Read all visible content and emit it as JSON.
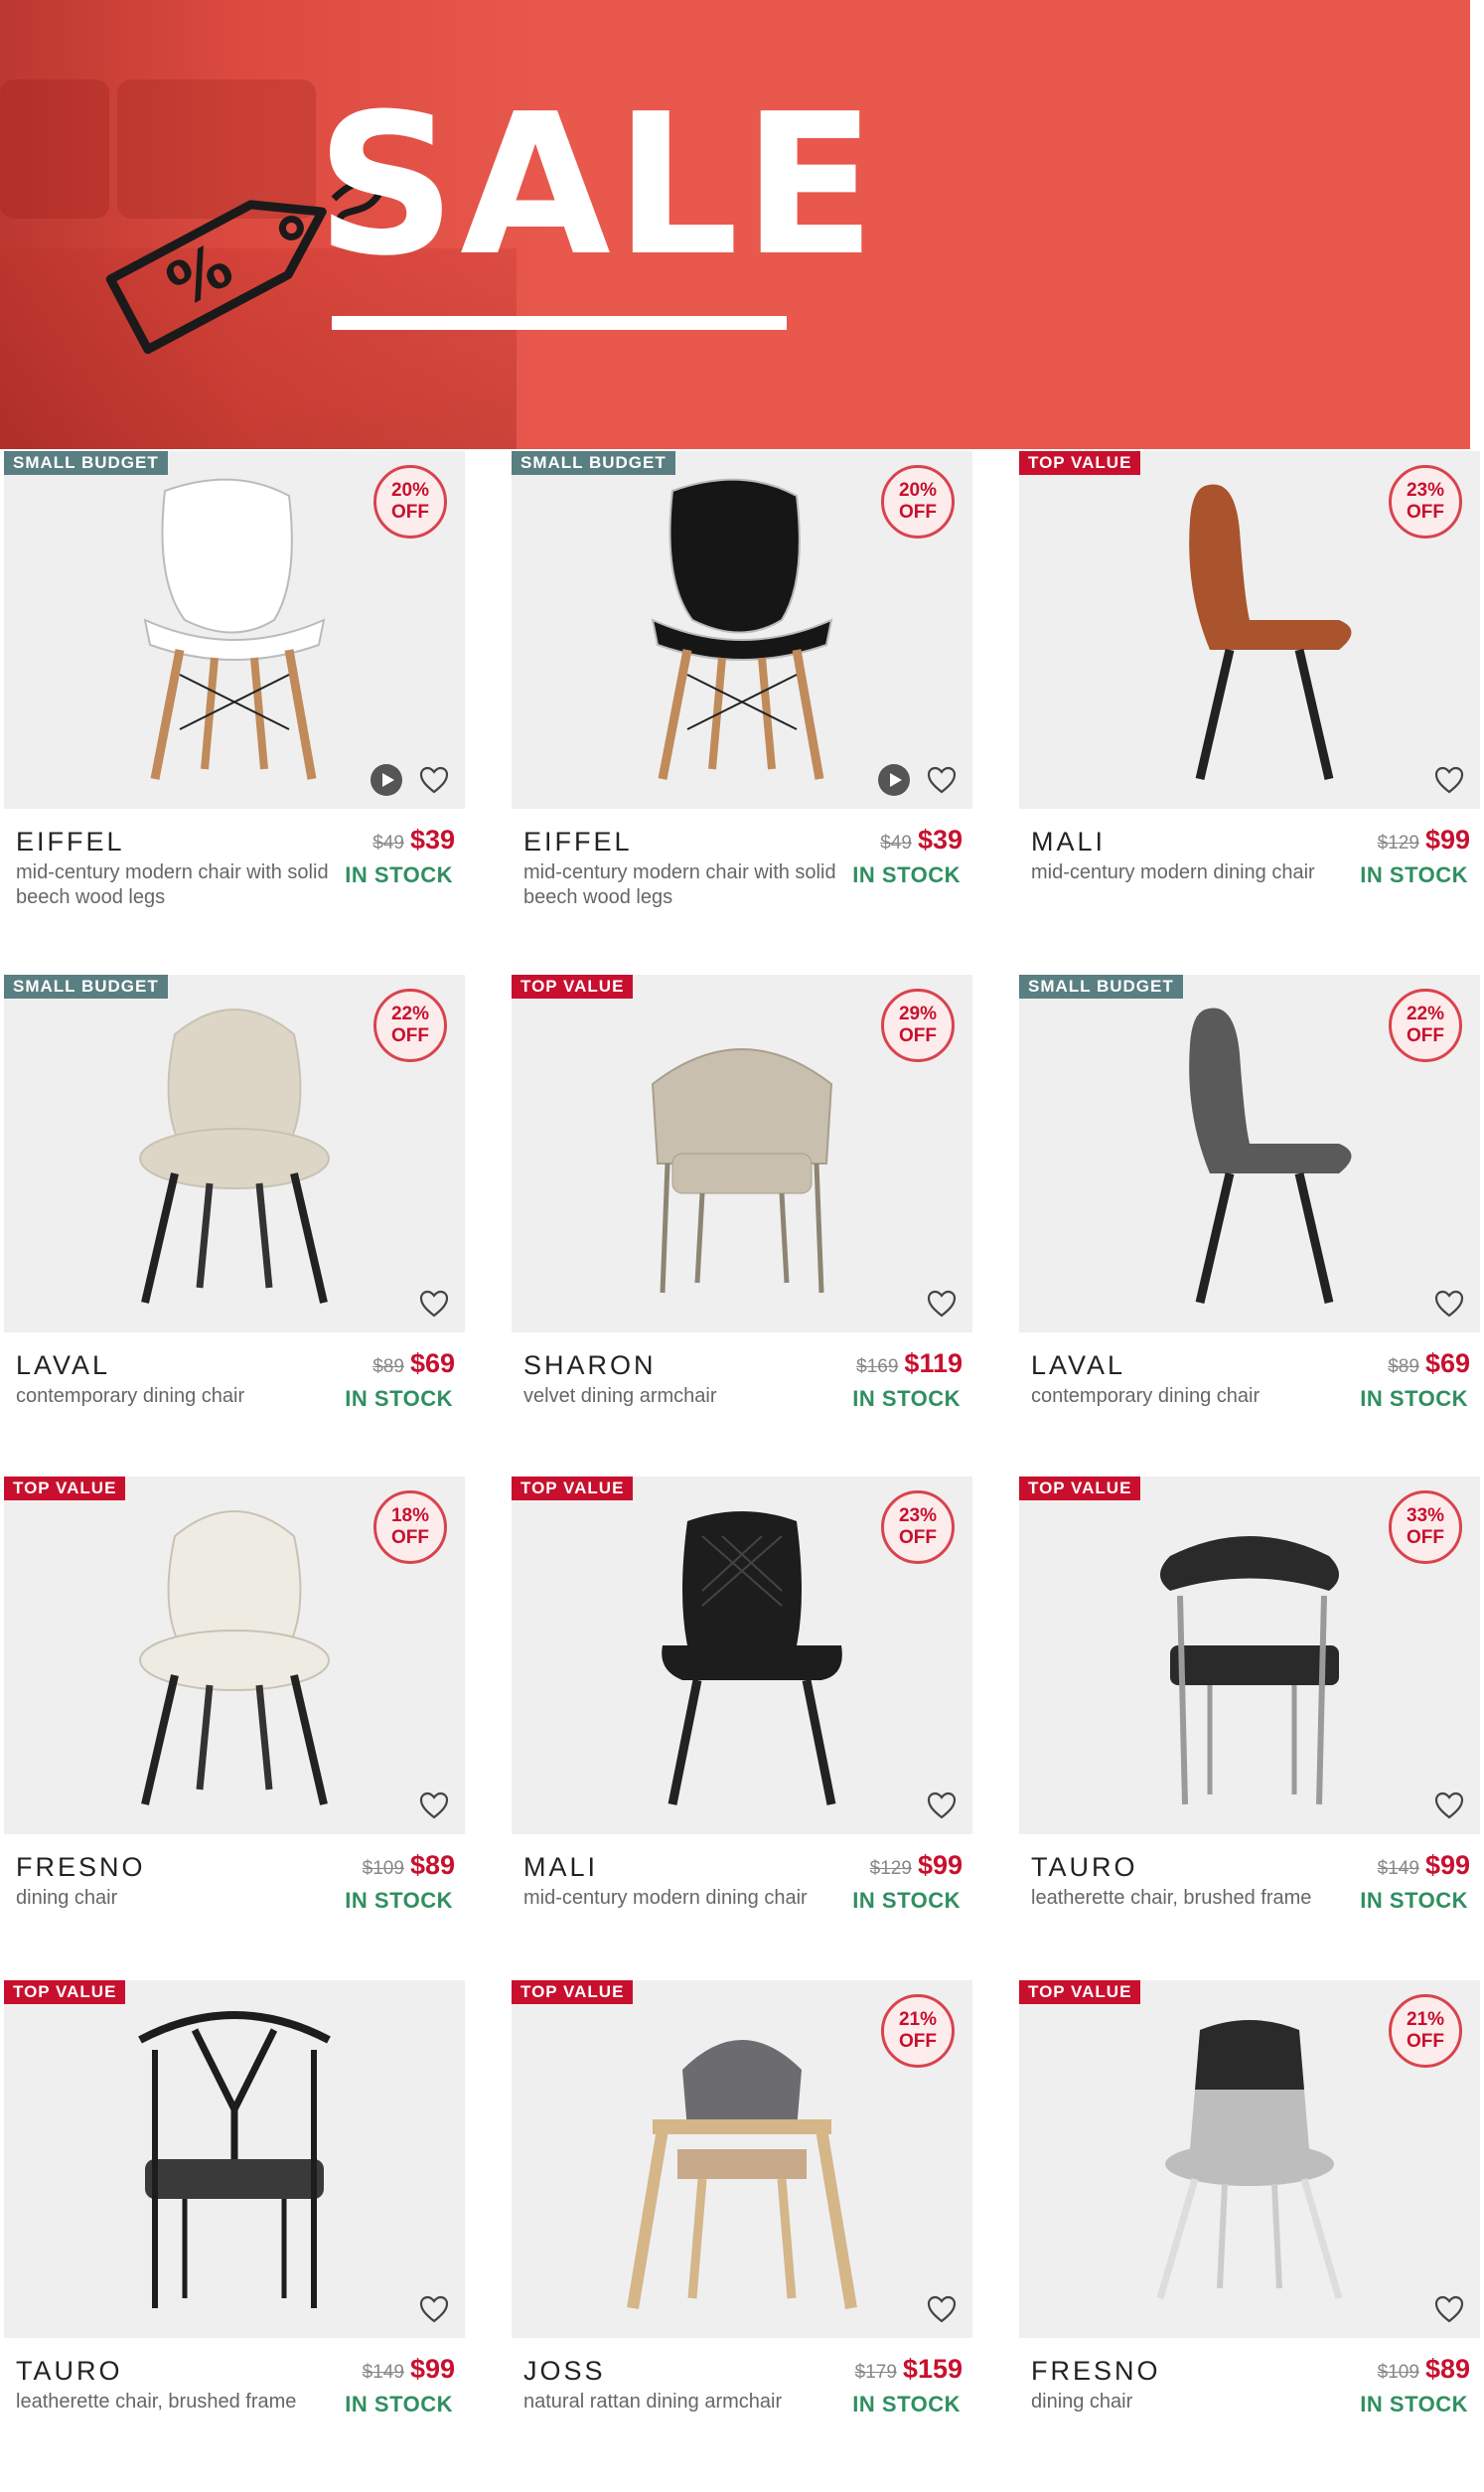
{
  "banner": {
    "title": "SALE",
    "tag_symbol": "%",
    "background_color": "#e8584d"
  },
  "colors": {
    "badge_small_budget": "#5a7f82",
    "badge_top_value": "#c8102e",
    "price_red": "#c8102e",
    "in_stock_green": "#2f8f5f"
  },
  "products": [
    {
      "badge": "SMALL BUDGET",
      "badge_type": "small",
      "discount_pct": "20%",
      "discount_off": "OFF",
      "name": "EIFFEL",
      "desc": "mid-century modern chair with solid beech wood legs",
      "old_price": "$49",
      "new_price": "$39",
      "stock": "IN STOCK",
      "has_video": true,
      "chair_color": "#ffffff",
      "chair_style": "eames"
    },
    {
      "badge": "SMALL BUDGET",
      "badge_type": "small",
      "discount_pct": "20%",
      "discount_off": "OFF",
      "name": "EIFFEL",
      "desc": "mid-century modern chair with solid beech wood legs",
      "old_price": "$49",
      "new_price": "$39",
      "stock": "IN STOCK",
      "has_video": true,
      "chair_color": "#161616",
      "chair_style": "eames"
    },
    {
      "badge": "TOP VALUE",
      "badge_type": "top",
      "discount_pct": "23%",
      "discount_off": "OFF",
      "name": "MALI",
      "desc": "mid-century modern dining chair",
      "old_price": "$129",
      "new_price": "$99",
      "stock": "IN STOCK",
      "has_video": false,
      "chair_color": "#a9542c",
      "chair_style": "shell"
    },
    {
      "badge": "SMALL BUDGET",
      "badge_type": "small",
      "discount_pct": "22%",
      "discount_off": "OFF",
      "name": "LAVAL",
      "desc": "contemporary dining chair",
      "old_price": "$89",
      "new_price": "$69",
      "stock": "IN STOCK",
      "has_video": false,
      "chair_color": "#ddd5c6",
      "chair_style": "round"
    },
    {
      "badge": "TOP VALUE",
      "badge_type": "top",
      "discount_pct": "29%",
      "discount_off": "OFF",
      "name": "SHARON",
      "desc": "velvet dining armchair",
      "old_price": "$169",
      "new_price": "$119",
      "stock": "IN STOCK",
      "has_video": false,
      "chair_color": "#c9bfae",
      "chair_style": "arm"
    },
    {
      "badge": "SMALL BUDGET",
      "badge_type": "small",
      "discount_pct": "22%",
      "discount_off": "OFF",
      "name": "LAVAL",
      "desc": "contemporary dining chair",
      "old_price": "$89",
      "new_price": "$69",
      "stock": "IN STOCK",
      "has_video": false,
      "chair_color": "#5a5a5a",
      "chair_style": "shell"
    },
    {
      "badge": "TOP VALUE",
      "badge_type": "top",
      "discount_pct": "18%",
      "discount_off": "OFF",
      "name": "FRESNO",
      "desc": "dining chair",
      "old_price": "$109",
      "new_price": "$89",
      "stock": "IN STOCK",
      "has_video": false,
      "chair_color": "#eeebe3",
      "chair_style": "round"
    },
    {
      "badge": "TOP VALUE",
      "badge_type": "top",
      "discount_pct": "23%",
      "discount_off": "OFF",
      "name": "MALI",
      "desc": "mid-century modern dining chair",
      "old_price": "$129",
      "new_price": "$99",
      "stock": "IN STOCK",
      "has_video": false,
      "chair_color": "#1d1d1d",
      "chair_style": "quilt"
    },
    {
      "badge": "TOP VALUE",
      "badge_type": "top",
      "discount_pct": "33%",
      "discount_off": "OFF",
      "name": "TAURO",
      "desc": "leatherette chair, brushed frame",
      "old_price": "$149",
      "new_price": "$99",
      "stock": "IN STOCK",
      "has_video": false,
      "chair_color": "#2a2a2a",
      "chair_style": "tauro"
    },
    {
      "badge": "TOP VALUE",
      "badge_type": "top",
      "discount_pct": "",
      "discount_off": "",
      "name": "TAURO",
      "desc": "leatherette chair, brushed frame",
      "old_price": "$149",
      "new_price": "$99",
      "stock": "IN STOCK",
      "has_video": false,
      "chair_color": "#1d1d1d",
      "chair_style": "wishbone"
    },
    {
      "badge": "TOP VALUE",
      "badge_type": "top",
      "discount_pct": "21%",
      "discount_off": "OFF",
      "name": "JOSS",
      "desc": "natural rattan dining armchair",
      "old_price": "$179",
      "new_price": "$159",
      "stock": "IN STOCK",
      "has_video": false,
      "chair_color": "#6b6b70",
      "chair_style": "joss"
    },
    {
      "badge": "TOP VALUE",
      "badge_type": "top",
      "discount_pct": "21%",
      "discount_off": "OFF",
      "name": "FRESNO",
      "desc": "dining chair",
      "old_price": "$109",
      "new_price": "$89",
      "stock": "IN STOCK",
      "has_video": false,
      "chair_color": "#bdbdbd",
      "chair_style": "fresno2"
    }
  ]
}
